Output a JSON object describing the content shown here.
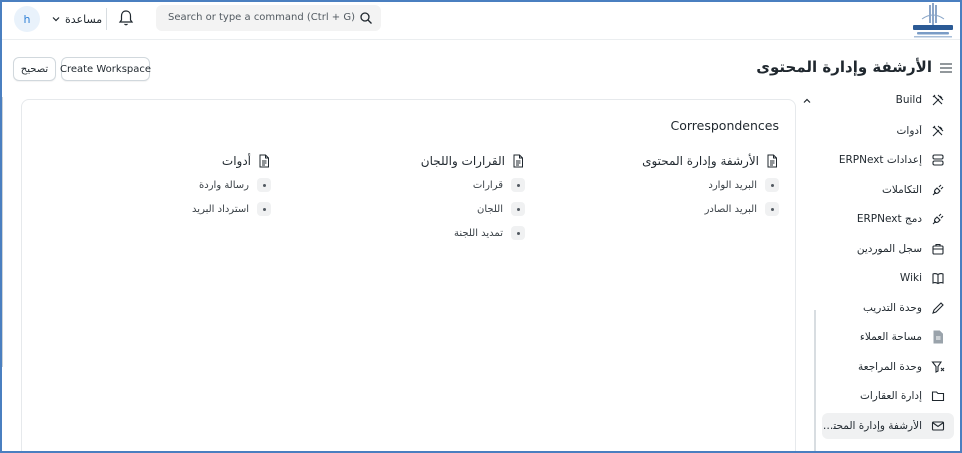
{
  "navbar": {
    "avatar_initial": "h",
    "help_label": "مساعدة",
    "search_placeholder": "Search or type a command (Ctrl + G)"
  },
  "header": {
    "title": "الأرشفة وإدارة المحتوى",
    "edit_button": "تصحيح",
    "create_workspace_button": "Create Workspace"
  },
  "card": {
    "title": "Correspondences",
    "columns": [
      {
        "heading": "الأرشفة وإدارة المحتوى",
        "links": [
          "البريد الوارد",
          "البريد الصادر"
        ]
      },
      {
        "heading": "القرارات واللجان",
        "links": [
          "قرارات",
          "اللجان",
          "تمديد اللجنة"
        ]
      },
      {
        "heading": "أدوات",
        "links": [
          "رسالة واردة",
          "استرداد البريد"
        ]
      }
    ]
  },
  "sidebar": {
    "items": [
      {
        "label": "Build",
        "icon": "tools-icon"
      },
      {
        "label": "أدوات",
        "icon": "tools-icon"
      },
      {
        "label": "إعدادات ERPNext",
        "icon": "database-icon"
      },
      {
        "label": "التكاملات",
        "icon": "plug-icon"
      },
      {
        "label": "دمج ERPNext",
        "icon": "plug-icon"
      },
      {
        "label": "سجل الموردين",
        "icon": "briefcase-icon"
      },
      {
        "label": "Wiki",
        "icon": "book-icon"
      },
      {
        "label": "وحدة التدريب",
        "icon": "pen-icon"
      },
      {
        "label": "مساحة العملاء",
        "icon": "file-icon"
      },
      {
        "label": "وحدة المراجعة",
        "icon": "filter-icon"
      },
      {
        "label": "إدارة العقارات",
        "icon": "folder-icon"
      },
      {
        "label": "الأرشفة وإدارة المحتو...",
        "icon": "mail-icon",
        "active": true
      }
    ]
  },
  "colors": {
    "accent": "#2f80d6",
    "frame_border": "#4a7fc0",
    "active_bg": "#f0f1f2"
  }
}
